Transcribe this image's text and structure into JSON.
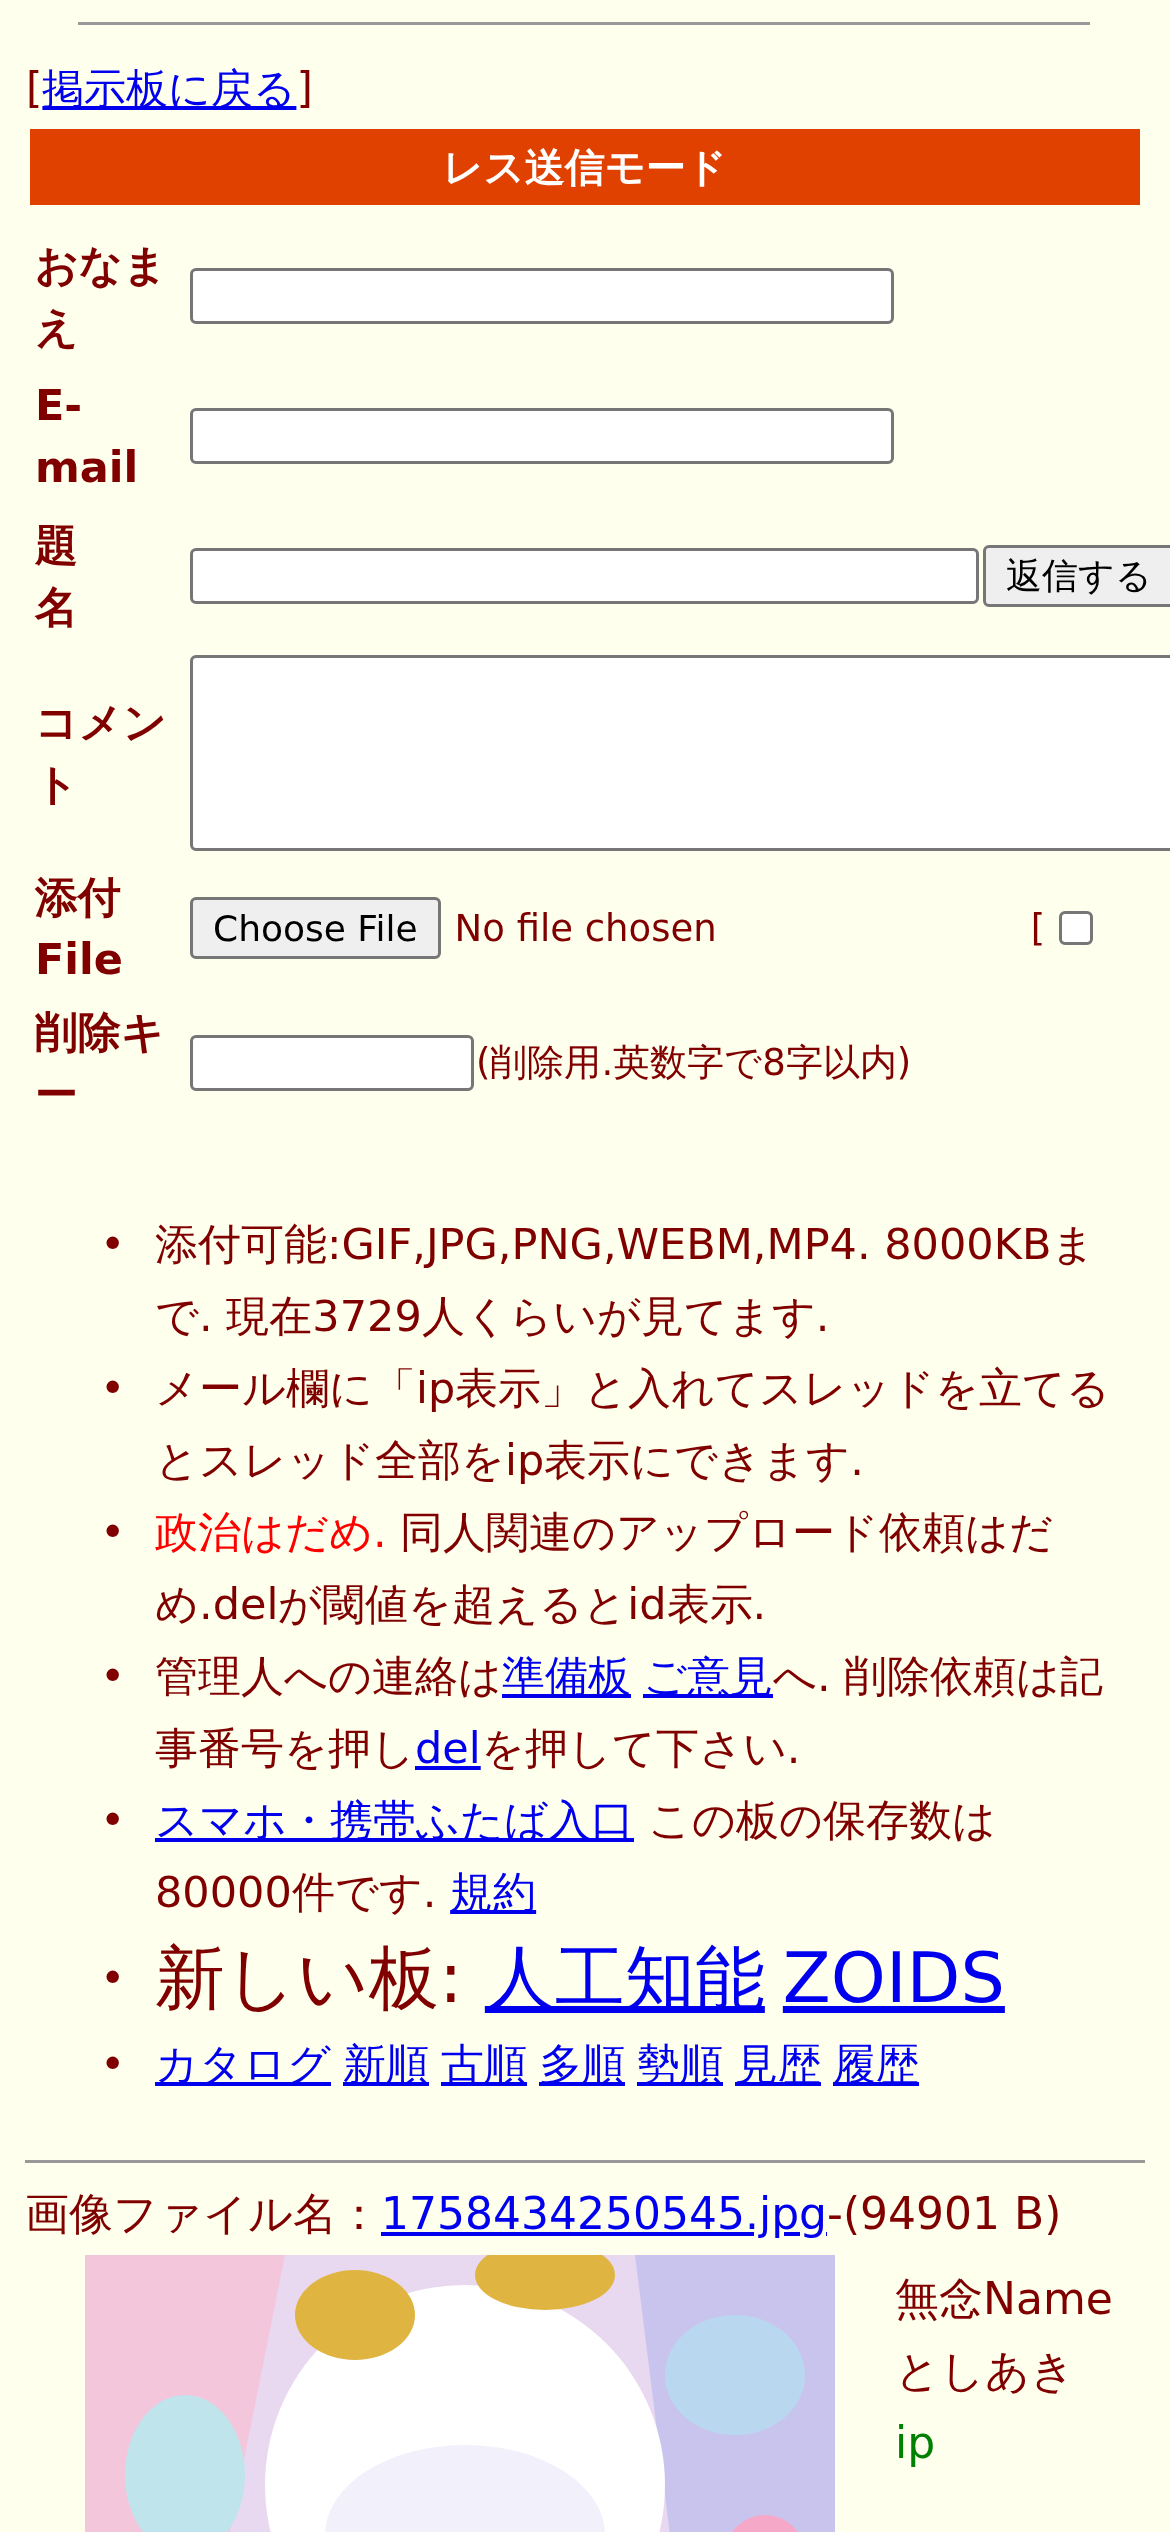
{
  "back_link": {
    "open": "[",
    "label": "掲示板に戻る",
    "close": "]"
  },
  "form": {
    "title": "レス送信モード",
    "fields": [
      {
        "kind": "text",
        "label": "おなまえ"
      },
      {
        "kind": "text",
        "label": "E-mail"
      },
      {
        "kind": "subject",
        "label": "題名",
        "button": "返信する"
      },
      {
        "kind": "textarea",
        "label": "コメント"
      },
      {
        "kind": "file",
        "label": "添付File",
        "button": "Choose File",
        "status": "No file chosen",
        "option": {
          "bracket": "[",
          "checked": false
        }
      },
      {
        "kind": "key",
        "label": "削除キー",
        "note": "(削除用.英数字で8字以内)"
      }
    ]
  },
  "notices": [
    {
      "kind": "normal",
      "marker": "•",
      "parts": [
        {
          "kind": "text",
          "text": "添付可能:GIF,JPG,PNG,WEBM,MP4. 8000KBまで. 現在3729人くらいが見てます."
        }
      ]
    },
    {
      "kind": "normal",
      "marker": "•",
      "parts": [
        {
          "kind": "text",
          "text": "メール欄に「ip表示」と入れてスレッドを立てるとスレッド全部をip表示にできます."
        }
      ]
    },
    {
      "kind": "normal",
      "marker": "•",
      "parts": [
        {
          "kind": "warning",
          "text": "政治はだめ."
        },
        {
          "kind": "text",
          "text": " 同人関連のアップロード依頼はだめ.delが閾値を超えるとid表示."
        }
      ]
    },
    {
      "kind": "normal",
      "marker": "•",
      "parts": [
        {
          "kind": "text",
          "text": "管理人への連絡は"
        },
        {
          "kind": "link",
          "text": "準備板"
        },
        {
          "kind": "link",
          "text": "ご意見"
        },
        {
          "kind": "text",
          "text": "へ. 削除依頼は記事番号を押し"
        },
        {
          "kind": "link",
          "text": "del"
        },
        {
          "kind": "text",
          "text": "を押して下さい."
        }
      ]
    },
    {
      "kind": "normal",
      "marker": "•",
      "parts": [
        {
          "kind": "link",
          "text": "スマホ・携帯ふたば入口"
        },
        {
          "kind": "text",
          "text": " この板の保存数は80000件です. "
        },
        {
          "kind": "link",
          "text": "規約"
        }
      ]
    },
    {
      "kind": "large",
      "marker": "•",
      "parts": [
        {
          "kind": "text",
          "text": "新しい板: "
        },
        {
          "kind": "link",
          "text": "人工知能"
        },
        {
          "kind": "link",
          "text": "ZOIDS"
        }
      ]
    },
    {
      "kind": "normal",
      "marker": "•",
      "parts": [
        {
          "kind": "link",
          "text": "カタログ"
        },
        {
          "kind": "link",
          "text": "新順"
        },
        {
          "kind": "link",
          "text": "古順"
        },
        {
          "kind": "link",
          "text": "多順"
        },
        {
          "kind": "link",
          "text": "勢順"
        },
        {
          "kind": "link",
          "text": "見歴"
        },
        {
          "kind": "link",
          "text": "履歴"
        }
      ]
    }
  ],
  "post": {
    "file_label": "画像ファイル名：",
    "file_link": "1758434250545.jpg",
    "file_size": "-(94901 B)",
    "subject": "無念Name",
    "name": "としあき",
    "ip": "ip"
  }
}
